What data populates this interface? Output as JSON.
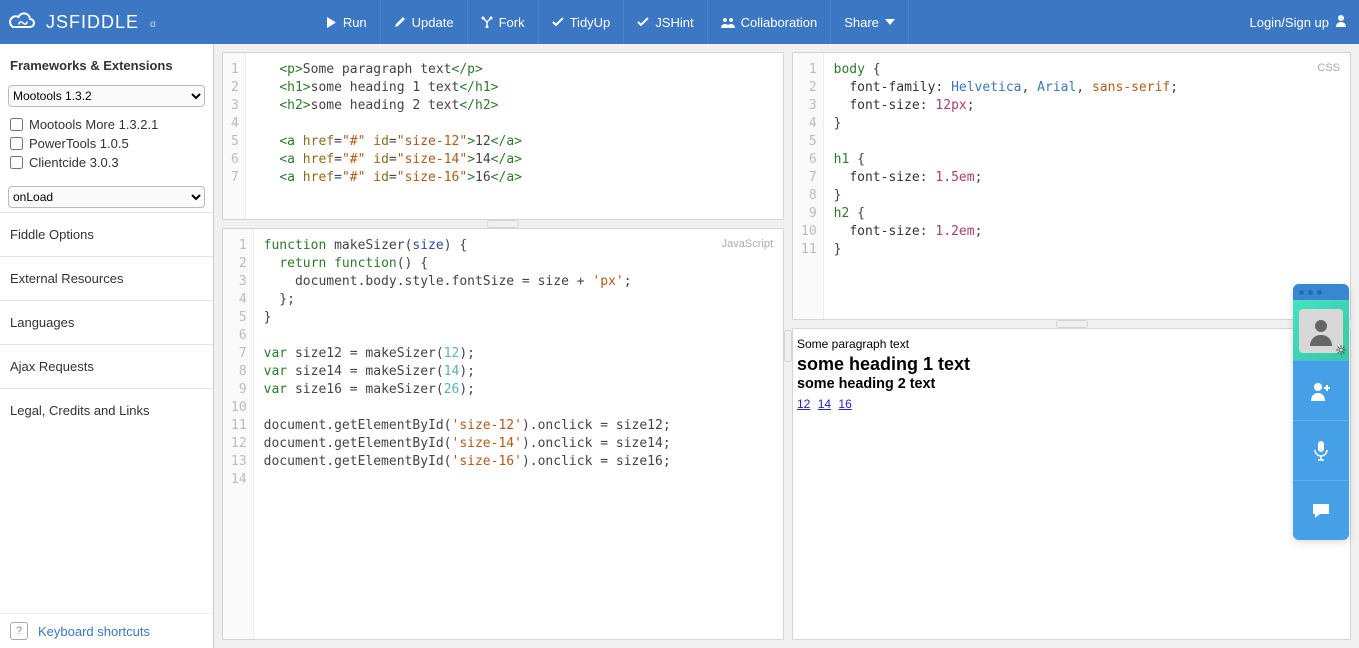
{
  "brand": {
    "name": "JSFIDDLE",
    "alpha": "α"
  },
  "topbar": {
    "run": "Run",
    "update": "Update",
    "fork": "Fork",
    "tidy": "TidyUp",
    "jshint": "JSHint",
    "collab": "Collaboration",
    "share": "Share",
    "login": "Login/Sign up"
  },
  "sidebar": {
    "frameworks_title": "Frameworks & Extensions",
    "framework_selected": "Mootools 1.3.2",
    "checks": [
      {
        "label": "Mootools More 1.3.2.1",
        "checked": false
      },
      {
        "label": "PowerTools 1.0.5",
        "checked": false
      },
      {
        "label": "Clientcide 3.0.3",
        "checked": false
      }
    ],
    "wrap_selected": "onLoad",
    "links": [
      "Fiddle Options",
      "External Resources",
      "Languages",
      "Ajax Requests",
      "Legal, Credits and Links"
    ],
    "kbd_help_label": "?",
    "kbd_link": "Keyboard shortcuts"
  },
  "panes": {
    "html": {
      "label": "",
      "lines": 7
    },
    "css": {
      "label": "CSS",
      "lines": 11
    },
    "js": {
      "label": "JavaScript",
      "lines": 14
    }
  },
  "html_code": {
    "l1_text": "Some paragraph text",
    "l2_text": "some heading 1 text",
    "l3_text": "some heading 2 text",
    "id12": "size-12",
    "t12": "12",
    "id14": "size-14",
    "t14": "14",
    "id16": "size-16",
    "t16": "16"
  },
  "css_code": {
    "ff_helv": "Helvetica",
    "ff_arial": "Arial",
    "ff_sans": "sans-serif",
    "body_fs": "12px",
    "h1_fs": "1.5em",
    "h2_fs": "1.2em"
  },
  "js_code": {
    "fn_name": "makeSizer",
    "param": "size",
    "px": "'px'",
    "v12": "12",
    "v14": "14",
    "v26": "26",
    "id12": "'size-12'",
    "id14": "'size-14'",
    "id16": "'size-16'",
    "s12": "size12",
    "s14": "size14",
    "s16": "size16"
  },
  "result": {
    "p": "Some paragraph text",
    "h1": "some heading 1 text",
    "h2": "some heading 2 text",
    "links": [
      "12",
      "14",
      "16"
    ]
  }
}
